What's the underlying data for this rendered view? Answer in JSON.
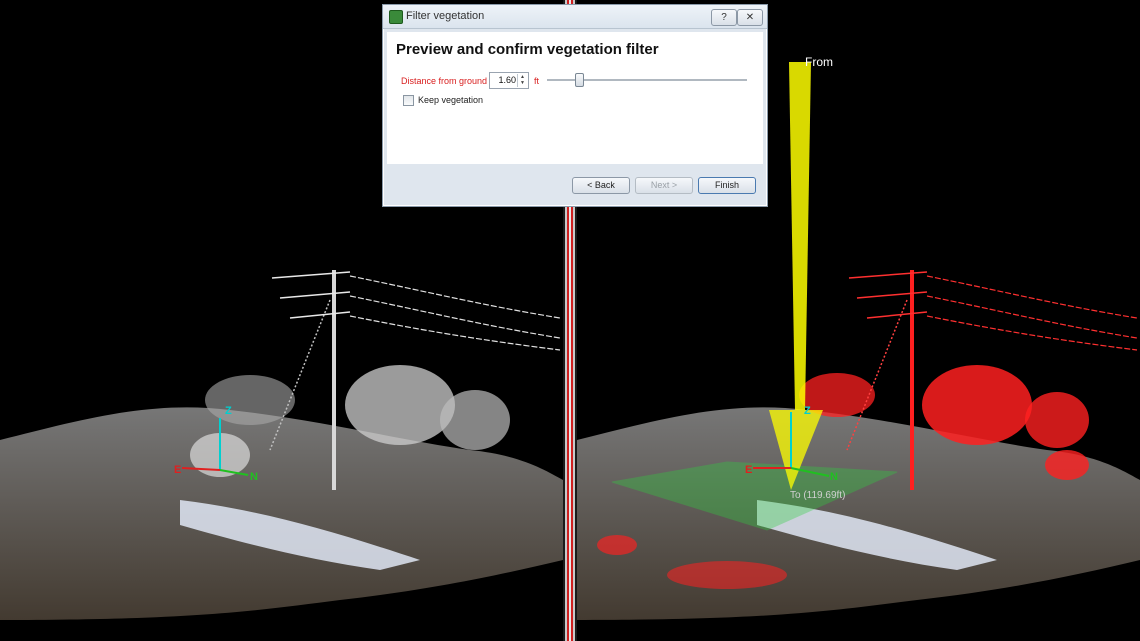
{
  "dialog": {
    "window_title": "Filter vegetation",
    "help_glyph": "?",
    "close_glyph": "✕",
    "heading": "Preview and confirm vegetation filter",
    "distance_label": "Distance from ground",
    "distance_value": "1.60",
    "spin_up": "▲",
    "spin_down": "▼",
    "unit": "ft",
    "keep_vegetation_label": "Keep vegetation",
    "keep_vegetation_checked": false,
    "back_label": "< Back",
    "next_label": "Next >",
    "finish_label": "Finish"
  },
  "viewports": {
    "left": {
      "axis_z": "Z",
      "axis_n": "N",
      "axis_e": "E"
    },
    "right": {
      "axis_z": "Z",
      "axis_n": "N",
      "axis_e": "E",
      "from_label": "From",
      "to_label": "To (119.69ft)"
    }
  },
  "colors": {
    "filtered_vegetation": "#ff2020",
    "ground_plane": "#30d040",
    "view_arrow": "#ffff00",
    "axis_z": "#00d0d0",
    "axis_n": "#20c020",
    "axis_e": "#e02020"
  }
}
